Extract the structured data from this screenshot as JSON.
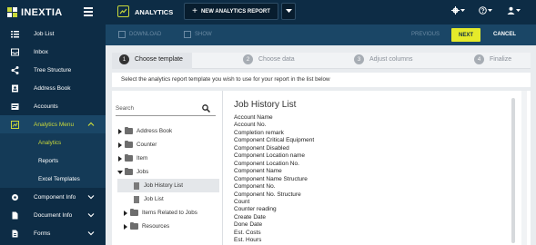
{
  "brand": {
    "name": "INEXTIA"
  },
  "sidebar": {
    "items": [
      {
        "label": "Job List",
        "icon": "list-icon"
      },
      {
        "label": "Inbox",
        "icon": "inbox-icon"
      },
      {
        "label": "Tree Structure",
        "icon": "tree-icon"
      },
      {
        "label": "Address Book",
        "icon": "address-book-icon"
      },
      {
        "label": "Accounts",
        "icon": "accounts-icon"
      },
      {
        "label": "Analytics Menu",
        "icon": "analytics-icon"
      },
      {
        "label": "Component Info",
        "icon": "component-icon"
      },
      {
        "label": "Document Info",
        "icon": "document-icon"
      },
      {
        "label": "Forms",
        "icon": "forms-icon"
      }
    ],
    "subitems": [
      {
        "label": "Analytics"
      },
      {
        "label": "Reports"
      },
      {
        "label": "Excel Templates"
      }
    ]
  },
  "header": {
    "title": "ANALYTICS",
    "new_button": "NEW ANALYTICS REPORT"
  },
  "toolbar": {
    "download": "DOWNLOAD",
    "show": "SHOW",
    "previous": "PREVIOUS",
    "next": "NEXT",
    "cancel": "CANCEL"
  },
  "steps": [
    {
      "num": "1",
      "label": "Choose template"
    },
    {
      "num": "2",
      "label": "Choose data"
    },
    {
      "num": "3",
      "label": "Adjust columns"
    },
    {
      "num": "4",
      "label": "Finalize"
    }
  ],
  "description": "Select the analytics report template you wish to use for your report in the list below",
  "search": {
    "placeholder": "Search"
  },
  "tree": {
    "address_book": "Address Book",
    "counter": "Counter",
    "item": "Item",
    "jobs": "Jobs",
    "job_history_list": "Job History List",
    "job_list": "Job List",
    "items_related": "Items Related to Jobs",
    "resources": "Resources"
  },
  "panel": {
    "title": "Job History List",
    "fields": [
      "Account Name",
      "Account No.",
      "Completion remark",
      "Component Critical Equipment",
      "Component Disabled",
      "Component Location name",
      "Component Location No.",
      "Component Name",
      "Component Name Structure",
      "Component No.",
      "Component No. Structure",
      "Count",
      "Counter reading",
      "Create Date",
      "Done Date",
      "Est. Costs",
      "Est. Hours"
    ]
  },
  "colors": {
    "accent": "#c9d83a",
    "next_button": "#e5ea2a",
    "sidebar": "#0d2c45"
  }
}
